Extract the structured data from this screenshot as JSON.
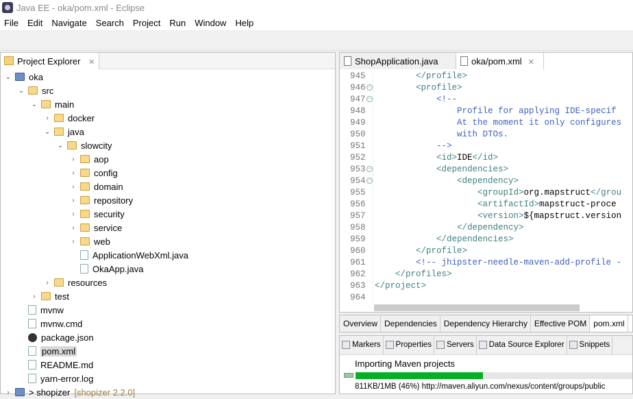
{
  "window": {
    "title": "Java EE - oka/pom.xml - Eclipse"
  },
  "menu": [
    "File",
    "Edit",
    "Navigate",
    "Search",
    "Project",
    "Run",
    "Window",
    "Help"
  ],
  "project_explorer": {
    "title": "Project Explorer",
    "items": [
      {
        "label": "oka",
        "level": 0,
        "chevron": "open",
        "icon": "project"
      },
      {
        "label": "src",
        "level": 1,
        "chevron": "open",
        "icon": "folder"
      },
      {
        "label": "main",
        "level": 2,
        "chevron": "open",
        "icon": "folder"
      },
      {
        "label": "docker",
        "level": 3,
        "chevron": "closed",
        "icon": "folder"
      },
      {
        "label": "java",
        "level": 3,
        "chevron": "open",
        "icon": "folder"
      },
      {
        "label": "slowcity",
        "level": 4,
        "chevron": "open",
        "icon": "folder"
      },
      {
        "label": "aop",
        "level": 5,
        "chevron": "closed",
        "icon": "folder"
      },
      {
        "label": "config",
        "level": 5,
        "chevron": "closed",
        "icon": "folder"
      },
      {
        "label": "domain",
        "level": 5,
        "chevron": "closed",
        "icon": "folder"
      },
      {
        "label": "repository",
        "level": 5,
        "chevron": "closed",
        "icon": "folder"
      },
      {
        "label": "security",
        "level": 5,
        "chevron": "closed",
        "icon": "folder"
      },
      {
        "label": "service",
        "level": 5,
        "chevron": "closed",
        "icon": "folder"
      },
      {
        "label": "web",
        "level": 5,
        "chevron": "closed",
        "icon": "folder"
      },
      {
        "label": "ApplicationWebXml.java",
        "level": 5,
        "chevron": "none",
        "icon": "file"
      },
      {
        "label": "OkaApp.java",
        "level": 5,
        "chevron": "none",
        "icon": "file"
      },
      {
        "label": "resources",
        "level": 3,
        "chevron": "closed",
        "icon": "folder"
      },
      {
        "label": "test",
        "level": 2,
        "chevron": "closed",
        "icon": "folder"
      },
      {
        "label": "mvnw",
        "level": 1,
        "chevron": "none",
        "icon": "file"
      },
      {
        "label": "mvnw.cmd",
        "level": 1,
        "chevron": "none",
        "icon": "file"
      },
      {
        "label": "package.json",
        "level": 1,
        "chevron": "none",
        "icon": "npm"
      },
      {
        "label": "pom.xml",
        "level": 1,
        "chevron": "none",
        "icon": "file",
        "selected": true
      },
      {
        "label": "README.md",
        "level": 1,
        "chevron": "none",
        "icon": "file"
      },
      {
        "label": "yarn-error.log",
        "level": 1,
        "chevron": "none",
        "icon": "file"
      },
      {
        "label": "> shopizer",
        "suffix": "[shopizer 2.2.0]",
        "level": 0,
        "chevron": "closed",
        "icon": "project"
      }
    ]
  },
  "editor": {
    "tabs": [
      {
        "label": "ShopApplication.java",
        "active": false
      },
      {
        "label": "oka/pom.xml",
        "active": true
      }
    ],
    "lines": [
      {
        "n": "945",
        "indent": "        ",
        "parts": [
          [
            "tag",
            "</profile>"
          ]
        ]
      },
      {
        "n": "946",
        "fold": true,
        "indent": "        ",
        "parts": [
          [
            "tag",
            "<profile>"
          ]
        ]
      },
      {
        "n": "947",
        "fold": true,
        "indent": "            ",
        "parts": [
          [
            "cm",
            "<!--"
          ]
        ]
      },
      {
        "n": "948",
        "indent": "                ",
        "parts": [
          [
            "cm",
            "Profile for applying IDE-specif"
          ]
        ]
      },
      {
        "n": "949",
        "indent": "                ",
        "parts": [
          [
            "cm",
            "At the moment it only configures"
          ]
        ]
      },
      {
        "n": "950",
        "indent": "                ",
        "parts": [
          [
            "cm",
            "with DTOs."
          ]
        ]
      },
      {
        "n": "951",
        "indent": "            ",
        "parts": [
          [
            "cm",
            "-->"
          ]
        ]
      },
      {
        "n": "952",
        "indent": "            ",
        "parts": [
          [
            "tag",
            "<id>"
          ],
          [
            "txt",
            "IDE"
          ],
          [
            "tag",
            "</id>"
          ]
        ]
      },
      {
        "n": "953",
        "fold": true,
        "indent": "            ",
        "parts": [
          [
            "tag",
            "<dependencies>"
          ]
        ]
      },
      {
        "n": "954",
        "fold": true,
        "indent": "                ",
        "parts": [
          [
            "tag",
            "<dependency>"
          ]
        ]
      },
      {
        "n": "955",
        "indent": "                    ",
        "parts": [
          [
            "tag",
            "<groupId>"
          ],
          [
            "txt",
            "org.mapstruct"
          ],
          [
            "tag",
            "</grou"
          ]
        ]
      },
      {
        "n": "956",
        "indent": "                    ",
        "parts": [
          [
            "tag",
            "<artifactId>"
          ],
          [
            "txt",
            "mapstruct-proce"
          ]
        ]
      },
      {
        "n": "957",
        "indent": "                    ",
        "parts": [
          [
            "tag",
            "<version>"
          ],
          [
            "txt",
            "${mapstruct.version"
          ]
        ]
      },
      {
        "n": "958",
        "indent": "                ",
        "parts": [
          [
            "tag",
            "</dependency>"
          ]
        ]
      },
      {
        "n": "959",
        "indent": "            ",
        "parts": [
          [
            "tag",
            "</dependencies>"
          ]
        ]
      },
      {
        "n": "960",
        "indent": "        ",
        "parts": [
          [
            "tag",
            "</profile>"
          ]
        ]
      },
      {
        "n": "961",
        "indent": "        ",
        "parts": [
          [
            "cm",
            "<!-- jhipster-needle-maven-add-profile -"
          ]
        ]
      },
      {
        "n": "962",
        "indent": "    ",
        "parts": [
          [
            "tag",
            "</profiles>"
          ]
        ]
      },
      {
        "n": "963",
        "indent": "",
        "parts": [
          [
            "tag",
            "</project>"
          ]
        ]
      },
      {
        "n": "964",
        "indent": "",
        "parts": []
      }
    ],
    "pom_tabs": [
      {
        "label": "Overview"
      },
      {
        "label": "Dependencies"
      },
      {
        "label": "Dependency Hierarchy"
      },
      {
        "label": "Effective POM"
      },
      {
        "label": "pom.xml",
        "active": true
      }
    ]
  },
  "bottom_panel": {
    "tabs": [
      "Markers",
      "Properties",
      "Servers",
      "Data Source Explorer",
      "Snippets"
    ],
    "progress": {
      "title": "Importing Maven projects",
      "percent": 46,
      "detail": "811KB/1MB (46%) http://maven.aliyun.com/nexus/content/groups/public"
    }
  },
  "colors": {
    "progress": "#06b025",
    "tag": "#3f7f7f",
    "comment": "#3f5fbf"
  }
}
